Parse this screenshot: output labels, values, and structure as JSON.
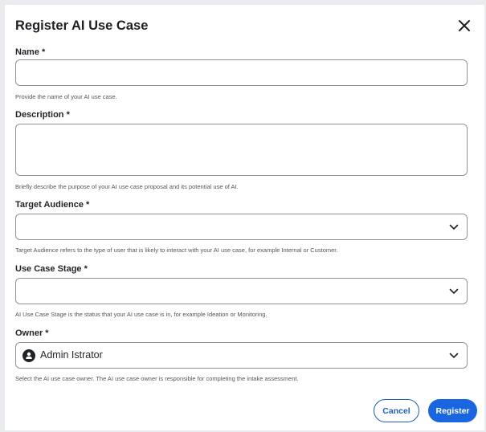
{
  "dialog": {
    "title": "Register AI Use Case",
    "fields": {
      "name": {
        "label": "Name *",
        "value": "",
        "help": "Provide the name of your AI use case."
      },
      "description": {
        "label": "Description *",
        "value": "",
        "help": "Briefly describe the purpose of your AI use case proposal and its potential use of AI."
      },
      "target_audience": {
        "label": "Target Audience *",
        "selected": "",
        "help": "Target Audience refers to the type of user that is likely to interact with your AI use case, for example Internal or Customer."
      },
      "use_case_stage": {
        "label": "Use Case Stage *",
        "selected": "",
        "help": "AI Use Case Stage is the status that your AI use case is in, for example Ideation or Monitoring."
      },
      "owner": {
        "label": "Owner *",
        "selected": "Admin Istrator",
        "help": "Select the AI use case owner. The AI use case owner is responsible for completing the intake assessment."
      }
    },
    "buttons": {
      "cancel": "Cancel",
      "register": "Register"
    },
    "icons": {
      "close": "close-icon",
      "chevron": "chevron-down-icon",
      "avatar": "user-avatar-icon"
    },
    "colors": {
      "primary": "#1a66e0",
      "border": "#8d949c",
      "text": "#1f2328",
      "help_text": "#50565e"
    }
  }
}
